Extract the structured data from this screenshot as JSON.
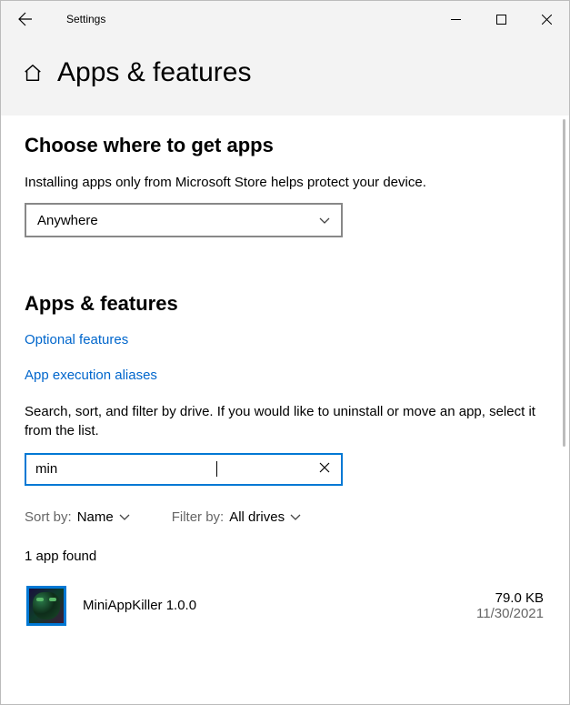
{
  "titlebar": {
    "title": "Settings"
  },
  "header": {
    "page_title": "Apps & features"
  },
  "source_section": {
    "heading": "Choose where to get apps",
    "desc": "Installing apps only from Microsoft Store helps protect your device.",
    "selected": "Anywhere"
  },
  "apps_section": {
    "heading": "Apps & features",
    "link_optional": "Optional features",
    "link_aliases": "App execution aliases",
    "desc": "Search, sort, and filter by drive. If you would like to uninstall or move an app, select it from the list.",
    "search_value": "min",
    "sort": {
      "label": "Sort by:",
      "value": "Name"
    },
    "filter": {
      "label": "Filter by:",
      "value": "All drives"
    },
    "count": "1 app found",
    "items": [
      {
        "name": "MiniAppKiller 1.0.0",
        "size": "79.0 KB",
        "date": "11/30/2021"
      }
    ]
  }
}
